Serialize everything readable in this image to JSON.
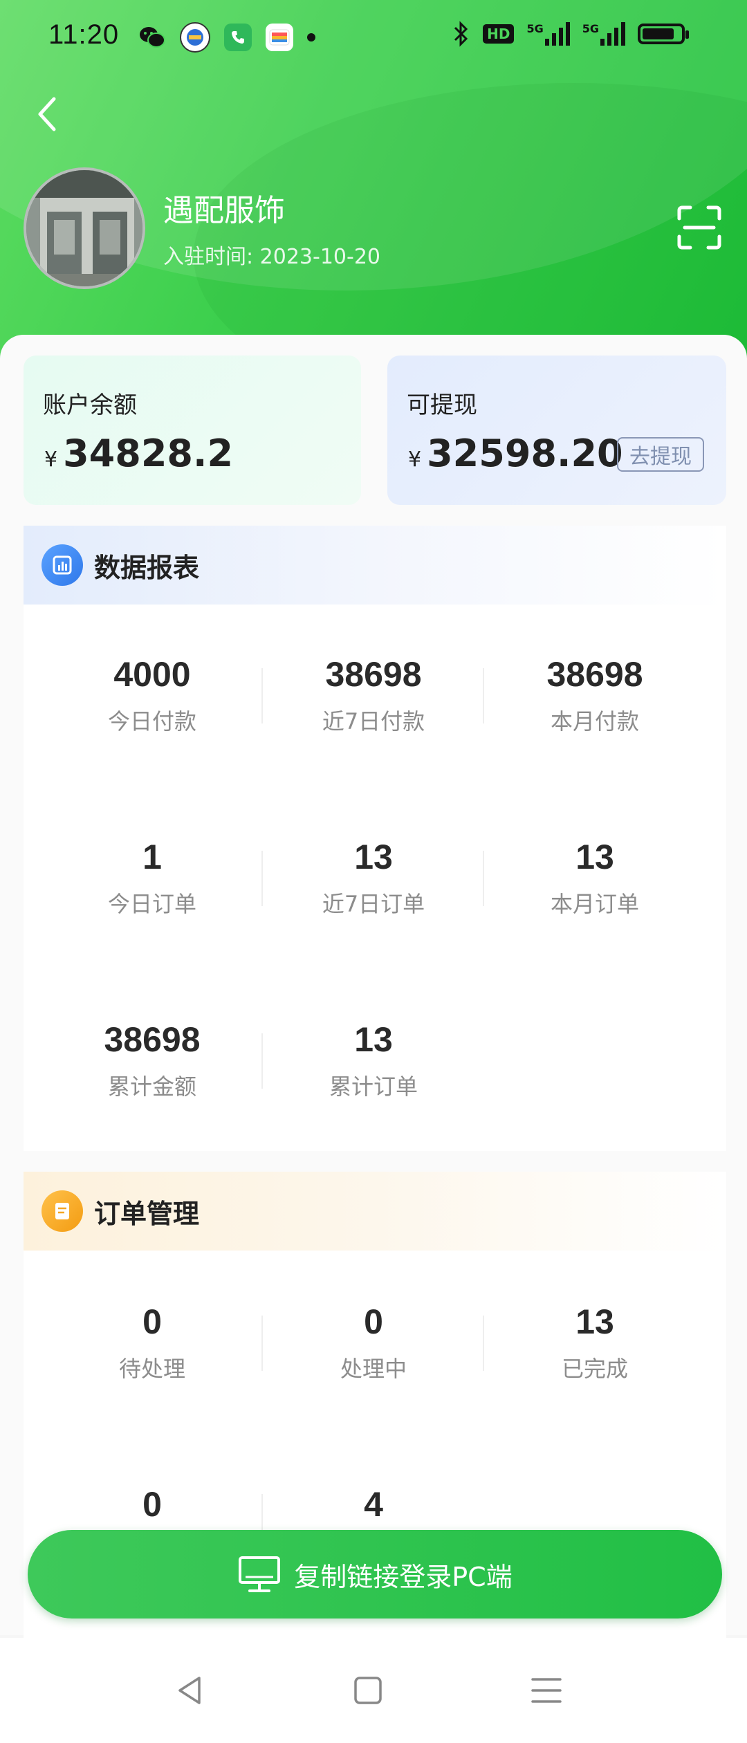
{
  "status_bar": {
    "time": "11:20",
    "hd_label": "HD",
    "net_1": "5G",
    "net_2": "5G"
  },
  "header": {
    "store_name": "遇配服饰",
    "join_label": "入驻时间:",
    "join_date": "2023-10-20"
  },
  "balance": {
    "account_label": "账户余额",
    "account_currency": "¥",
    "account_value": "34828.2",
    "withdrawable_label": "可提现",
    "withdrawable_currency": "¥",
    "withdrawable_value": "32598.20",
    "withdraw_button": "去提现"
  },
  "data_report": {
    "title": "数据报表",
    "stats": [
      {
        "value": "4000",
        "label": "今日付款"
      },
      {
        "value": "38698",
        "label": "近7日付款"
      },
      {
        "value": "38698",
        "label": "本月付款"
      },
      {
        "value": "1",
        "label": "今日订单"
      },
      {
        "value": "13",
        "label": "近7日订单"
      },
      {
        "value": "13",
        "label": "本月订单"
      },
      {
        "value": "38698",
        "label": "累计金额"
      },
      {
        "value": "13",
        "label": "累计订单"
      }
    ]
  },
  "order_mgmt": {
    "title": "订单管理",
    "stats": [
      {
        "value": "0",
        "label": "待处理"
      },
      {
        "value": "0",
        "label": "处理中"
      },
      {
        "value": "13",
        "label": "已完成"
      },
      {
        "value": "0",
        "label": ""
      },
      {
        "value": "4",
        "label": ""
      }
    ]
  },
  "pc_login": {
    "label": "复制链接登录PC端"
  },
  "colors": {
    "brand_green": "#22c03f",
    "report_icon_blue": "#3d8af5",
    "order_icon_orange": "#f5a623"
  }
}
